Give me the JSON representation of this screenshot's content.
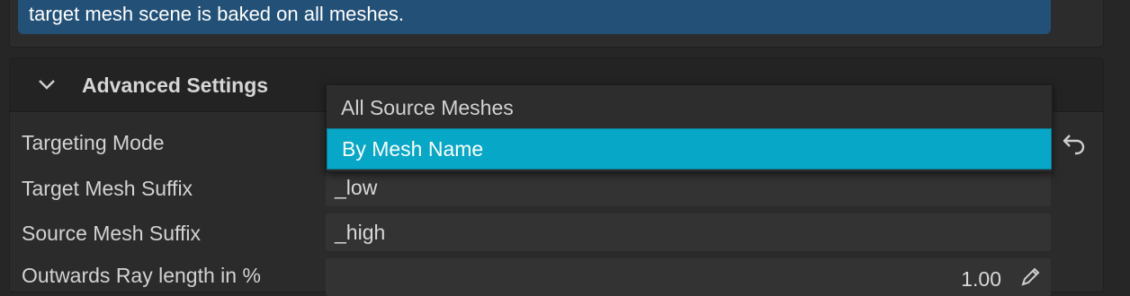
{
  "info_banner": {
    "text": "target mesh scene is baked on all meshes."
  },
  "advanced_settings": {
    "title": "Advanced Settings",
    "rows": [
      {
        "label": "Targeting Mode"
      },
      {
        "label": "Target Mesh Suffix",
        "value": "_low"
      },
      {
        "label": "Source Mesh Suffix",
        "value": "_high"
      },
      {
        "label": "Outwards Ray length in %",
        "value": "1.00"
      }
    ]
  },
  "targeting_dropdown": {
    "options": [
      "All Source Meshes",
      "By Mesh Name"
    ],
    "selected": "By Mesh Name"
  },
  "colors": {
    "accent": "#06a7c7",
    "banner": "#225077"
  },
  "icons": [
    "chevron-down-icon",
    "reset-icon",
    "pencil-icon"
  ]
}
